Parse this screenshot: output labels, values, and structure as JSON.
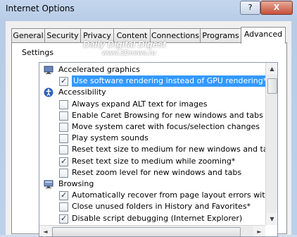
{
  "window": {
    "title": "Internet Options",
    "help_label": "?",
    "close_label": "X"
  },
  "tabs": [
    "General",
    "Security",
    "Privacy",
    "Content",
    "Connections",
    "Programs",
    "Advanced"
  ],
  "active_tab": "Advanced",
  "settings_label": "Settings",
  "watermark": {
    "line1": "Daily Digital Digest",
    "line2": "www.3Dnews.ru"
  },
  "items": [
    {
      "type": "category",
      "icon": "monitor-icon",
      "label": "Accelerated graphics"
    },
    {
      "type": "check",
      "checked": true,
      "selected": true,
      "label": "Use software rendering instead of GPU rendering*"
    },
    {
      "type": "category",
      "icon": "accessibility-icon",
      "label": "Accessibility"
    },
    {
      "type": "check",
      "checked": false,
      "label": "Always expand ALT text for images"
    },
    {
      "type": "check",
      "checked": false,
      "label": "Enable Caret Browsing for new windows and tabs"
    },
    {
      "type": "check",
      "checked": false,
      "label": "Move system caret with focus/selection changes"
    },
    {
      "type": "check",
      "checked": false,
      "label": "Play system sounds"
    },
    {
      "type": "check",
      "checked": false,
      "label": "Reset text size to medium for new windows and tabs"
    },
    {
      "type": "check",
      "checked": true,
      "label": "Reset text size to medium while zooming*"
    },
    {
      "type": "check",
      "checked": false,
      "label": "Reset zoom level for new windows and tabs"
    },
    {
      "type": "category",
      "icon": "browsing-icon",
      "label": "Browsing"
    },
    {
      "type": "check",
      "checked": true,
      "label": "Automatically recover from page layout errors with Compa"
    },
    {
      "type": "check",
      "checked": false,
      "label": "Close unused folders in History and Favorites*"
    },
    {
      "type": "check",
      "checked": true,
      "label": "Disable script debugging (Internet Explorer)"
    }
  ]
}
